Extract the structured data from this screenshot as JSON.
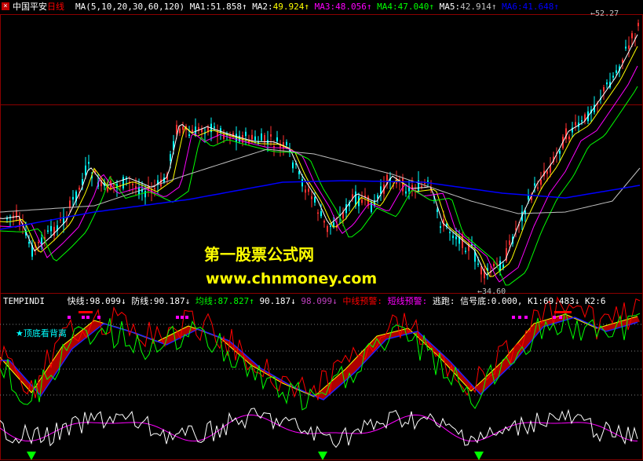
{
  "title": {
    "stock": "中国平安",
    "period": "日线"
  },
  "ma_header": {
    "label": "MA(5,10,20,30,60,120)",
    "items": [
      {
        "name": "MA1:",
        "value": "51.858↑",
        "color": "#ffffff"
      },
      {
        "name": "MA2:",
        "value": "49.924↑",
        "color": "#ffff00"
      },
      {
        "name": "MA3:",
        "value": "48.056↑",
        "color": "#ff00ff"
      },
      {
        "name": "MA4:",
        "value": "47.040↑",
        "color": "#00ff00"
      },
      {
        "name": "MA5:",
        "value": "42.914↑",
        "color": "#c0c0c0"
      },
      {
        "name": "MA6:",
        "value": "41.648↑",
        "color": "#0000ff"
      }
    ]
  },
  "price_marks": {
    "high": "52.27",
    "low": "34.60"
  },
  "watermark": {
    "line1": "第一股票公式网",
    "line2": "www.chnmoney.com"
  },
  "indicator_header": {
    "name": "TEMPINDI",
    "items": [
      {
        "name": "快线:",
        "value": "98.099↓",
        "color": "#ffffff"
      },
      {
        "name": "防线:",
        "value": "90.187↓",
        "color": "#ffffff"
      },
      {
        "name": "均线:",
        "value": "87.827↑",
        "color": "#00ff00"
      },
      {
        "name": "",
        "value": "90.187↓",
        "color": "#ffffff"
      },
      {
        "name": "",
        "value": "98.099↓",
        "color": "#c040c0"
      },
      {
        "name": "中线预警:",
        "value": "",
        "color": "#ff0000"
      },
      {
        "name": "短线预警:",
        "value": "",
        "color": "#ff00ff"
      },
      {
        "name": "逃跑:",
        "value": "",
        "color": "#ffffff"
      },
      {
        "name": "信号底:",
        "value": "0.000,",
        "color": "#ffffff"
      },
      {
        "name": "K1:",
        "value": "69.483↓",
        "color": "#ffffff"
      },
      {
        "name": "K2:",
        "value": "6",
        "color": "#ffffff"
      }
    ]
  },
  "annotation": "★顶底看背离",
  "colors": {
    "up": "#ff3030",
    "down": "#00ffff",
    "frame": "#8b0000",
    "ma1": "#ffffff",
    "ma2": "#ffff00",
    "ma3": "#ff00ff",
    "ma4": "#00ff00",
    "ma5": "#c0c0c0",
    "ma6": "#0000ff",
    "fast": "#ff0000",
    "slow": "#ffffff",
    "mid": "#00ff00"
  }
}
